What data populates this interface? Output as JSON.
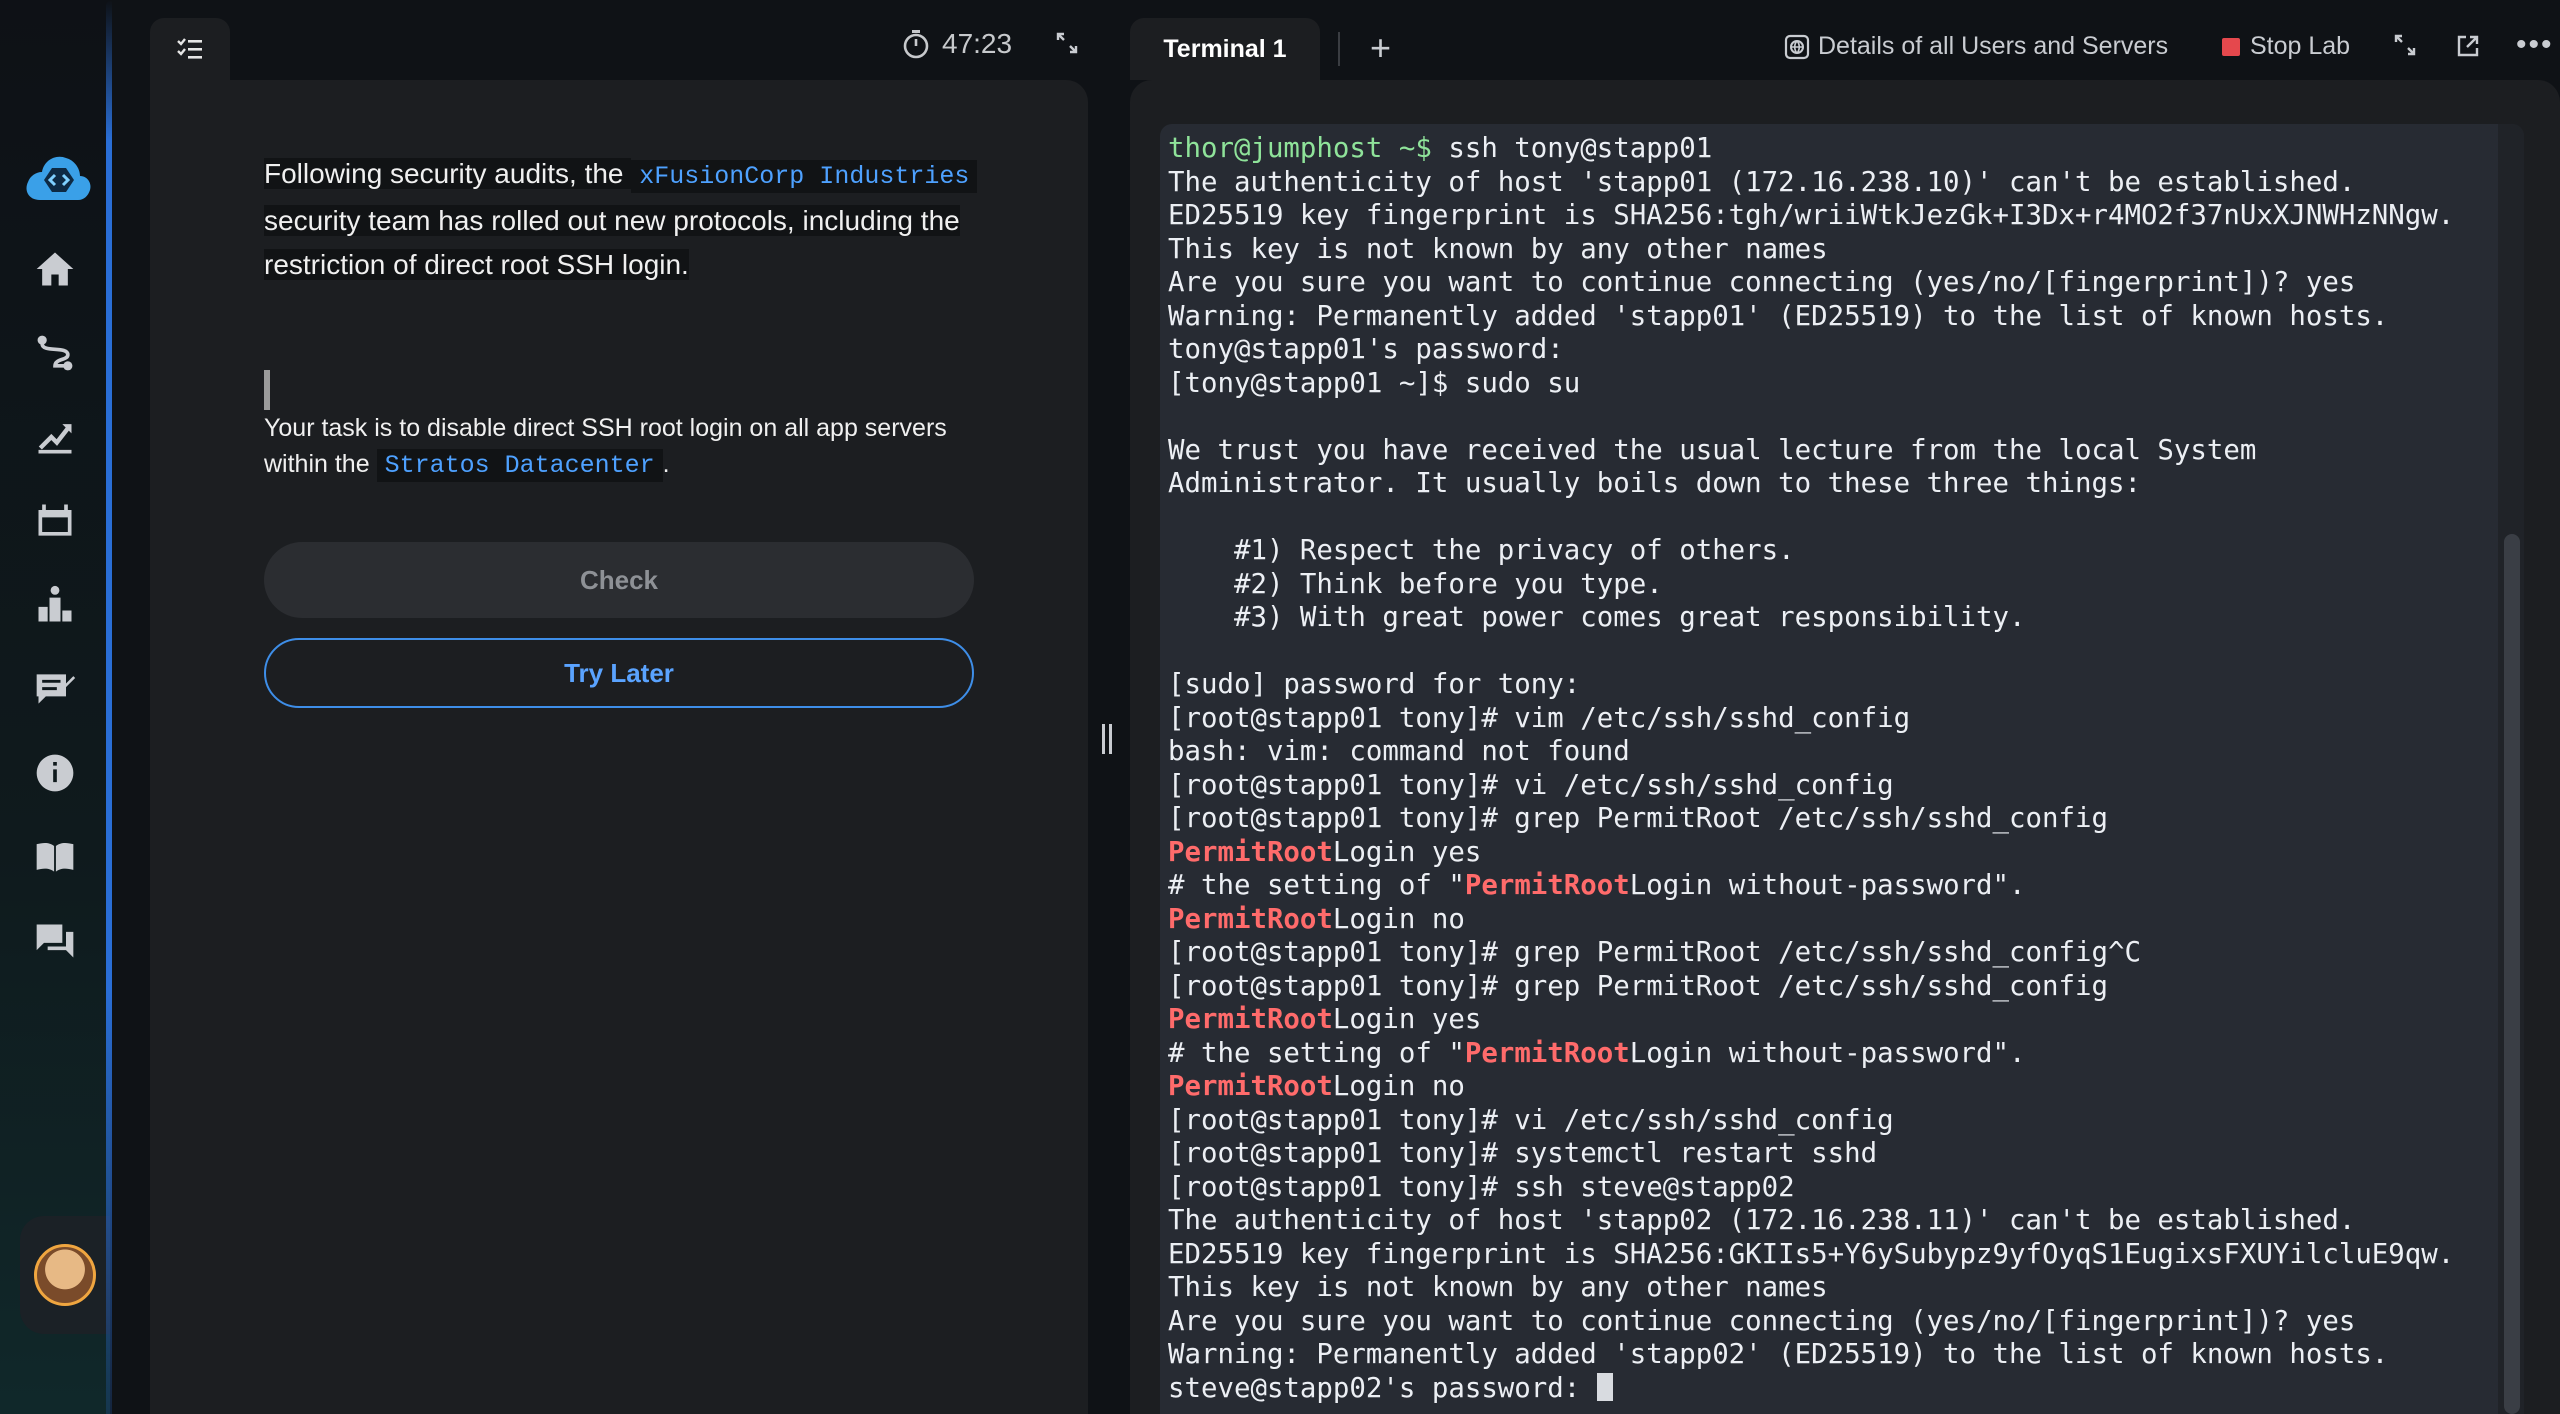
{
  "sidebar": {
    "logo_icon": "cloud-code-icon",
    "items": [
      {
        "icon": "home-icon"
      },
      {
        "icon": "route-icon"
      },
      {
        "icon": "progress-chart-icon"
      },
      {
        "icon": "labs-icon"
      },
      {
        "icon": "leaderboard-icon"
      },
      {
        "icon": "feedback-icon"
      },
      {
        "icon": "info-icon"
      },
      {
        "icon": "book-icon"
      },
      {
        "icon": "chat-icon"
      }
    ],
    "avatar_icon": "user-avatar-icon"
  },
  "task": {
    "timer": "47:23",
    "paragraph1": {
      "before": "Following security audits, the ",
      "code": "xFusionCorp Industries",
      "after": " security team has rolled out new protocols, including the restriction of direct root SSH login."
    },
    "paragraph2": {
      "before": "Your task is to disable direct SSH root login on all app servers within the ",
      "code": "Stratos Datacenter",
      "after": "."
    },
    "check_label": "Check",
    "try_later_label": "Try Later"
  },
  "terminal": {
    "tab_label": "Terminal 1",
    "details_label": "Details of all Users and Servers",
    "stop_label": "Stop Lab",
    "colors": {
      "prompt": "#8fe39a",
      "match": "#ff6b6b",
      "stop": "#e5484d",
      "accent": "#3e8ee8"
    },
    "lines": [
      [
        {
          "t": "thor@jumphost ~$",
          "c": "g"
        },
        {
          "t": " ssh tony@stapp01"
        }
      ],
      [
        {
          "t": "The authenticity of host 'stapp01 (172.16.238.10)' can't be established."
        }
      ],
      [
        {
          "t": "ED25519 key fingerprint is SHA256:tgh/wriiWtkJezGk+I3Dx+r4MO2f37nUxXJNWHzNNgw."
        }
      ],
      [
        {
          "t": "This key is not known by any other names"
        }
      ],
      [
        {
          "t": "Are you sure you want to continue connecting (yes/no/[fingerprint])? yes"
        }
      ],
      [
        {
          "t": "Warning: Permanently added 'stapp01' (ED25519) to the list of known hosts."
        }
      ],
      [
        {
          "t": "tony@stapp01's password:"
        }
      ],
      [
        {
          "t": "[tony@stapp01 ~]$ sudo su"
        }
      ],
      [
        {
          "t": ""
        }
      ],
      [
        {
          "t": "We trust you have received the usual lecture from the local System"
        }
      ],
      [
        {
          "t": "Administrator. It usually boils down to these three things:"
        }
      ],
      [
        {
          "t": ""
        }
      ],
      [
        {
          "t": "    #1) Respect the privacy of others."
        }
      ],
      [
        {
          "t": "    #2) Think before you type."
        }
      ],
      [
        {
          "t": "    #3) With great power comes great responsibility."
        }
      ],
      [
        {
          "t": ""
        }
      ],
      [
        {
          "t": "[sudo] password for tony:"
        }
      ],
      [
        {
          "t": "[root@stapp01 tony]# vim /etc/ssh/sshd_config"
        }
      ],
      [
        {
          "t": "bash: vim: command not found"
        }
      ],
      [
        {
          "t": "[root@stapp01 tony]# vi /etc/ssh/sshd_config"
        }
      ],
      [
        {
          "t": "[root@stapp01 tony]# grep PermitRoot /etc/ssh/sshd_config"
        }
      ],
      [
        {
          "t": "PermitRoot",
          "c": "r"
        },
        {
          "t": "Login yes"
        }
      ],
      [
        {
          "t": "# the setting of \""
        },
        {
          "t": "PermitRoot",
          "c": "r"
        },
        {
          "t": "Login without-password\"."
        }
      ],
      [
        {
          "t": "PermitRoot",
          "c": "r"
        },
        {
          "t": "Login no"
        }
      ],
      [
        {
          "t": "[root@stapp01 tony]# grep PermitRoot /etc/ssh/sshd_config^C"
        }
      ],
      [
        {
          "t": "[root@stapp01 tony]# grep PermitRoot /etc/ssh/sshd_config"
        }
      ],
      [
        {
          "t": "PermitRoot",
          "c": "r"
        },
        {
          "t": "Login yes"
        }
      ],
      [
        {
          "t": "# the setting of \""
        },
        {
          "t": "PermitRoot",
          "c": "r"
        },
        {
          "t": "Login without-password\"."
        }
      ],
      [
        {
          "t": "PermitRoot",
          "c": "r"
        },
        {
          "t": "Login no"
        }
      ],
      [
        {
          "t": "[root@stapp01 tony]# vi /etc/ssh/sshd_config"
        }
      ],
      [
        {
          "t": "[root@stapp01 tony]# systemctl restart sshd"
        }
      ],
      [
        {
          "t": "[root@stapp01 tony]# ssh steve@stapp02"
        }
      ],
      [
        {
          "t": "The authenticity of host 'stapp02 (172.16.238.11)' can't be established."
        }
      ],
      [
        {
          "t": "ED25519 key fingerprint is SHA256:GKIIs5+Y6ySubypz9yfOyqS1EugixsFXUYilcluE9qw."
        }
      ],
      [
        {
          "t": "This key is not known by any other names"
        }
      ],
      [
        {
          "t": "Are you sure you want to continue connecting (yes/no/[fingerprint])? yes"
        }
      ],
      [
        {
          "t": "Warning: Permanently added 'stapp02' (ED25519) to the list of known hosts."
        }
      ],
      [
        {
          "t": "steve@stapp02's password: "
        },
        {
          "cursor": true
        }
      ]
    ]
  }
}
